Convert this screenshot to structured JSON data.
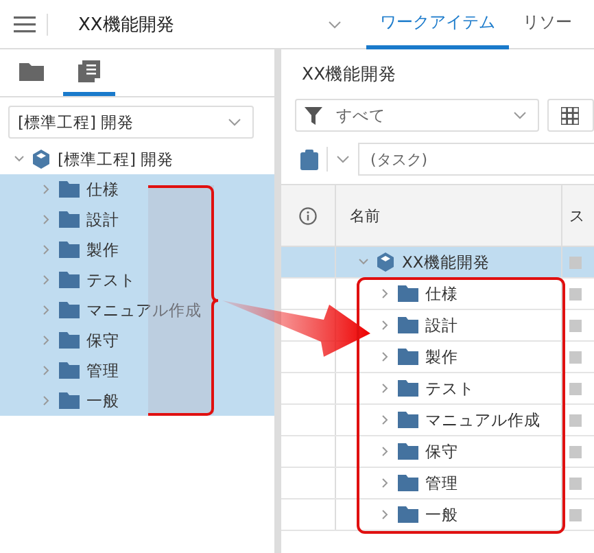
{
  "top_bar": {
    "title": "XX機能開発",
    "tabs": [
      {
        "label": "ワークアイテム",
        "selected": true
      },
      {
        "label": "リソー",
        "selected": false
      }
    ]
  },
  "left_panel": {
    "view_tabs": [
      {
        "kind": "folder",
        "selected": false
      },
      {
        "kind": "document",
        "selected": true
      }
    ],
    "process_select": "[標準工程] 開発",
    "tree": {
      "label": "[標準工程] 開発",
      "expanded": true,
      "selected": false,
      "children": [
        {
          "label": "仕様",
          "selected": true
        },
        {
          "label": "設計",
          "selected": true
        },
        {
          "label": "製作",
          "selected": true
        },
        {
          "label": "テスト",
          "selected": true
        },
        {
          "label": "マニュアル作成",
          "selected": true
        },
        {
          "label": "保守",
          "selected": true
        },
        {
          "label": "管理",
          "selected": true
        },
        {
          "label": "一般",
          "selected": true
        }
      ]
    }
  },
  "right_panel": {
    "title": "XX機能開発",
    "filter_select": "すべて",
    "type_field": "(タスク)",
    "table": {
      "columns": [
        "名前",
        "ス"
      ],
      "root": {
        "name": "XX機能開発",
        "expanded": true,
        "selected": true,
        "checked": false,
        "children": [
          {
            "name": "仕様",
            "selected": false,
            "checked": false
          },
          {
            "name": "設計",
            "selected": false,
            "checked": false
          },
          {
            "name": "製作",
            "selected": false,
            "checked": false
          },
          {
            "name": "テスト",
            "selected": false,
            "checked": false
          },
          {
            "name": "マニュアル作成",
            "selected": false,
            "checked": false
          },
          {
            "name": "保守",
            "selected": false,
            "checked": false
          },
          {
            "name": "管理",
            "selected": false,
            "checked": false
          },
          {
            "name": "一般",
            "selected": false,
            "checked": false
          }
        ]
      }
    }
  }
}
